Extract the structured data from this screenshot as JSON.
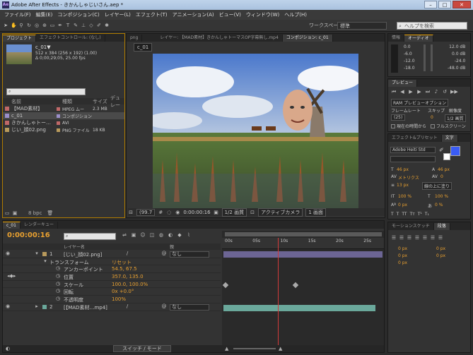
{
  "window": {
    "title": "Adobe After Effects - きかんしゃじいさん.aep *",
    "controls": [
      "–",
      "□",
      "✕"
    ]
  },
  "menu": [
    "ファイル(F)",
    "編集(E)",
    "コンポジション(C)",
    "レイヤー(L)",
    "エフェクト(T)",
    "アニメーション(A)",
    "ビュー(V)",
    "ウィンドウ(W)",
    "ヘルプ(H)"
  ],
  "toolbar": {
    "workspace_label": "ワークスペース：",
    "workspace_value": "標準",
    "help_placeholder": "ヘルプを検索"
  },
  "project": {
    "tabs": [
      "プロジェクト",
      "エフェクトコントロール: (なし)"
    ],
    "asset_name": "c_01▼",
    "asset_lines": [
      "512 x 384 (256 x 192) (1.00)",
      "Δ 0;00;29;05, 25.00 fps"
    ],
    "columns": [
      "名前",
      "種類",
      "サイズ",
      "デュレー"
    ],
    "items": [
      {
        "name": "【MAD素材】",
        "type": "MPEG ムー",
        "size": "2.3 MB",
        "color": "#c06868"
      },
      {
        "name": "c_01",
        "type": "コンポジション",
        "size": "",
        "color": "#9b8fc9",
        "selected": true
      },
      {
        "name": "きかんしゃトー…",
        "type": "AVI",
        "size": "",
        "color": "#c06868"
      },
      {
        "name": "じい_顔02.png",
        "type": "PNG ファイル",
        "size": "18 KB",
        "color": "#b89a5c"
      }
    ],
    "bpc": "8 bpc"
  },
  "viewer": {
    "tabs": [
      "png",
      "レイヤー: 【MAD素材】きかんしゃトーマスOP字幕無し.mp4",
      "コンポジション: c_01"
    ],
    "comp_chip": "c_01",
    "zoom": "(99.7",
    "timecode": "0:00:00:16",
    "resolution": "1/2 画質",
    "camera": "アクティブカメラ",
    "views": "1 画面"
  },
  "info": {
    "tabs": [
      "情報",
      "オーディオ"
    ],
    "left_db": [
      "0.0",
      "-6.0",
      "-12.0",
      "-18.0"
    ],
    "right_db": [
      "12.0 dB",
      "0.0 dB",
      "-24.0",
      "-48.0 dB"
    ]
  },
  "preview": {
    "tab": "プレビュー",
    "ram_label": "RAM プレビューオプション",
    "frame_rate": "フレームレート",
    "skip": "スキップ",
    "resolution": "解像度",
    "fps_value": "(25)",
    "skip_value": "0",
    "res_value": "1/2 画質",
    "from_current": "現在の時間から",
    "fullscreen": "フルスクリーン"
  },
  "effects": {
    "tabs": [
      "エフェクト&プリセット",
      "文字"
    ],
    "font": "Adobe Heiti Std",
    "font_size": "46 px",
    "leading": "46 px",
    "tracking_label": "メトリクス",
    "tracking": "0",
    "stroke": "13 px",
    "stroke_mode": "線の上に塗り",
    "v_scale": "100 %",
    "h_scale": "100 %",
    "baseline": "0 px",
    "tsume": "0 %",
    "fill_color": "#3a5cf5"
  },
  "paragraph": {
    "tabs": [
      "モーションスケッチ",
      "段落"
    ],
    "values": [
      "0 px",
      "0 px",
      "0 px",
      "0 px",
      "0 px"
    ]
  },
  "timeline": {
    "tabs": [
      "c_01",
      "レンダーキュー"
    ],
    "timecode": "0:00:00:16",
    "columns": {
      "layer_name": "レイヤー名",
      "parent": "親"
    },
    "ruler": [
      "00s",
      "05s",
      "10s",
      "15s",
      "20s",
      "25s"
    ],
    "layers": [
      {
        "num": "1",
        "name": "[じい_顔02.png]",
        "parent": "なし",
        "color": "#b89a5c"
      },
      {
        "num": "2",
        "name": "[【MAD素材…mp4]",
        "parent": "なし",
        "color": "#6aa89b"
      }
    ],
    "transform_label": "トランスフォーム",
    "transform_reset": "リセット",
    "props": [
      {
        "name": "アンカーポイント",
        "value": "54.5, 67.5"
      },
      {
        "name": "位置",
        "value": "357.0, 135.0"
      },
      {
        "name": "スケール",
        "value": "100.0, 100.0%"
      },
      {
        "name": "回転",
        "value": "0x +0.0°"
      },
      {
        "name": "不透明度",
        "value": "100%"
      }
    ],
    "switch_mode": "スイッチ / モード",
    "current_time_fraction": 0.354
  }
}
